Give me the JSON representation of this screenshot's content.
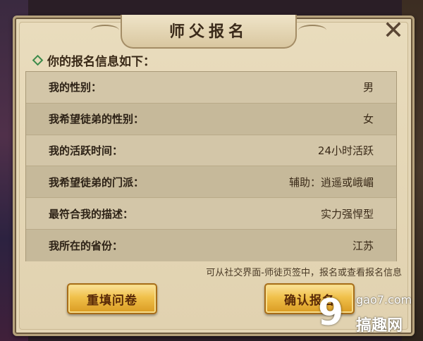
{
  "dialog": {
    "title": "师父报名",
    "close_icon": "close-icon"
  },
  "section": {
    "header": "你的报名信息如下："
  },
  "rows": [
    {
      "label": "我的性别：",
      "value": "男"
    },
    {
      "label": "我希望徒弟的性别：",
      "value": "女"
    },
    {
      "label": "我的活跃时间：",
      "value": "24小时活跃"
    },
    {
      "label": "我希望徒弟的门派：",
      "value": "辅助：逍遥或峨嵋"
    },
    {
      "label": "最符合我的描述：",
      "value": "实力强悍型"
    },
    {
      "label": "我所在的省份：",
      "value": "江苏"
    }
  ],
  "hint": "可从社交界面-师徒页签中，报名或查看报名信息",
  "buttons": {
    "refill": "重填问卷",
    "confirm": "确认报名"
  },
  "watermark": {
    "logo": "9",
    "url": "gao7.com",
    "name": "搞趣网"
  },
  "colors": {
    "panel": "#e4d6b6",
    "button_gold": "#f0c04a",
    "accent_green": "#3c8a4a"
  }
}
